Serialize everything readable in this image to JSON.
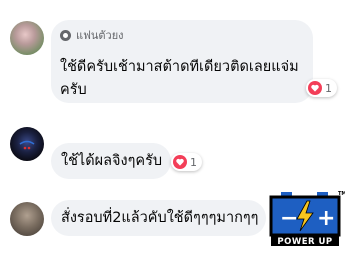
{
  "comments": [
    {
      "badge": "แฟนตัวยง",
      "lines": [
        "ใช้ดีครับเช้ามาสต้าดทีเดียวติดเลยแจ่ม",
        "ครับ"
      ],
      "reaction_count": "1"
    },
    {
      "text": "ใช้ได้ผลจิงๆครับ",
      "reaction_count": "1"
    },
    {
      "text": "สั่งรอบที่2แล้วคับใช้ดีๆๆๆมากๆๆ"
    }
  ],
  "logo": {
    "text": "POWER UP",
    "trademark": "TM",
    "minus": "−",
    "plus": "+"
  },
  "colors": {
    "bubble": "#f0f2f5",
    "reaction_heart": "#f33e58",
    "logo_blue": "#1e5fc2",
    "logo_yellow": "#f7c51e"
  }
}
